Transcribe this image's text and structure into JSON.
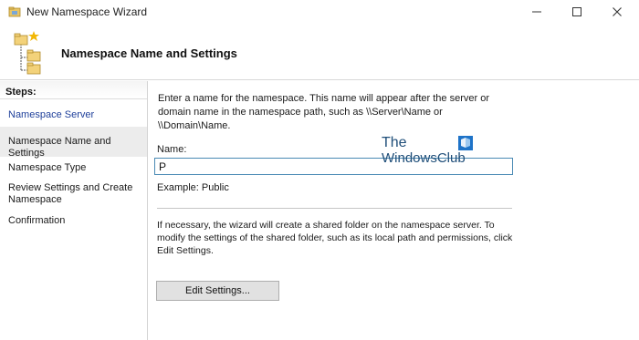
{
  "window": {
    "title": "New Namespace Wizard",
    "minimize_glyph": "—",
    "maximize_glyph": "☐",
    "close_glyph": "✕"
  },
  "header": {
    "title": "Namespace Name and Settings",
    "icon": "namespace-wizard-icon"
  },
  "steps": {
    "heading": "Steps:",
    "items": [
      {
        "label": "Namespace Server"
      },
      {
        "label": "Namespace Name and Settings"
      },
      {
        "label": "Namespace Type"
      },
      {
        "label": "Review Settings and Create Namespace"
      },
      {
        "label": "Confirmation"
      }
    ],
    "link_color": "#1e3f9a",
    "selected_background": "#ececec"
  },
  "main": {
    "intro": "Enter a name for the namespace. This name will appear after the server or domain name in the namespace path, such as \\\\Server\\Name or \\\\Domain\\Name.",
    "name_label": "Name:",
    "name_value": "P",
    "example": "Example: Public",
    "note": "If necessary, the wizard will create a shared folder on the namespace server. To modify the settings of the shared folder, such as its local path and permissions, click Edit Settings.",
    "edit_settings_label": "Edit Settings..."
  },
  "watermark": {
    "line1": "The",
    "line2": "WindowsClub",
    "color": "#1f4e79"
  }
}
